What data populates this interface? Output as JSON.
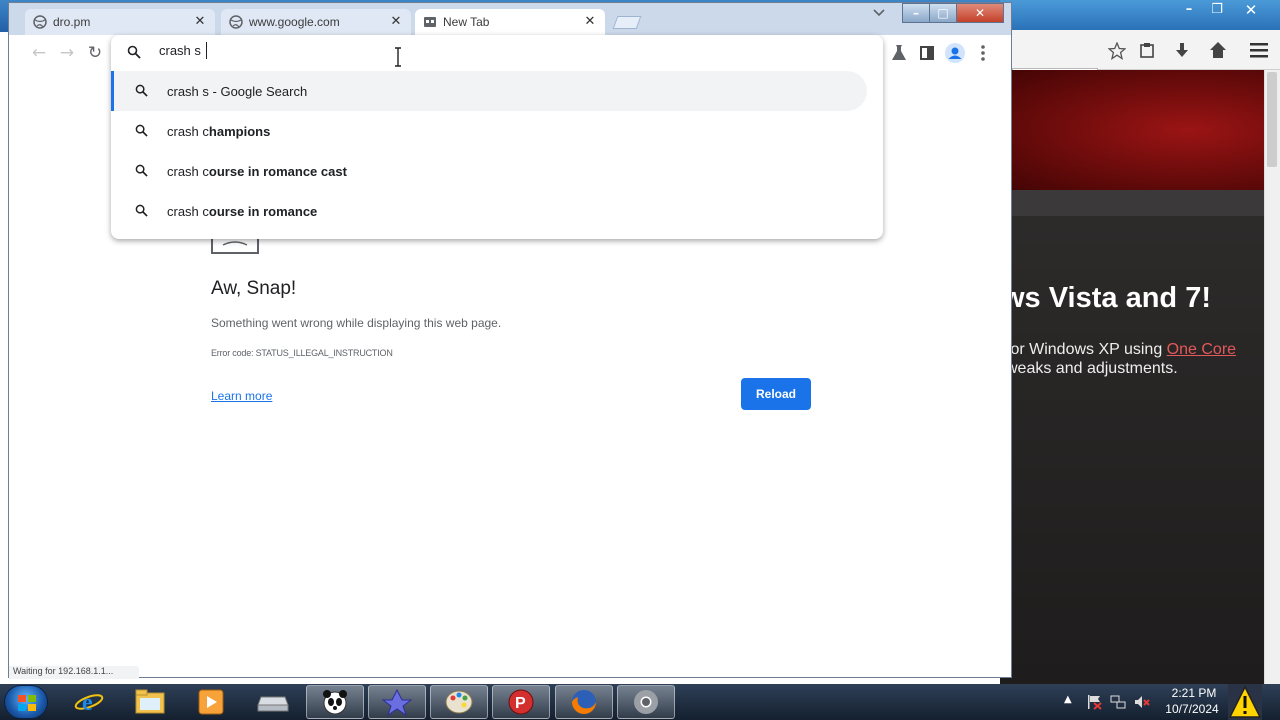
{
  "browser": {
    "tabs": [
      {
        "title": "dro.pm",
        "active": false,
        "favicon": "globe-icon"
      },
      {
        "title": "www.google.com",
        "active": false,
        "favicon": "globe-icon"
      },
      {
        "title": "New Tab",
        "active": true,
        "favicon": "new-tab-icon"
      }
    ],
    "omnibox": {
      "text": "crash s",
      "suggestions": [
        {
          "typed": "crash s",
          "completion": "",
          "suffix": " - Google Search",
          "selected": true
        },
        {
          "typed": "crash c",
          "completion": "hampions",
          "suffix": "",
          "selected": false
        },
        {
          "typed": "crash c",
          "completion": "ourse in romance cast",
          "suffix": "",
          "selected": false
        },
        {
          "typed": "crash c",
          "completion": "ourse in romance",
          "suffix": "",
          "selected": false
        }
      ]
    },
    "status_text": "Waiting for 192.168.1.1..."
  },
  "error_page": {
    "title": "Aw, Snap!",
    "message": "Something went wrong while displaying this web page.",
    "error_code": "Error code: STATUS_ILLEGAL_INSTRUCTION",
    "learn_more": "Learn more",
    "reload": "Reload"
  },
  "background_page": {
    "heading": "ws Vista and 7!",
    "line1_pre": "for Windows XP using ",
    "line1_link": "One Core",
    "line2": "weaks and adjustments."
  },
  "taskbar": {
    "time": "2:21 PM",
    "date": "10/7/2024"
  },
  "colors": {
    "accent": "#1a73e8",
    "link_on_dark": "#e2595b",
    "hero_red": "#9b1414"
  }
}
